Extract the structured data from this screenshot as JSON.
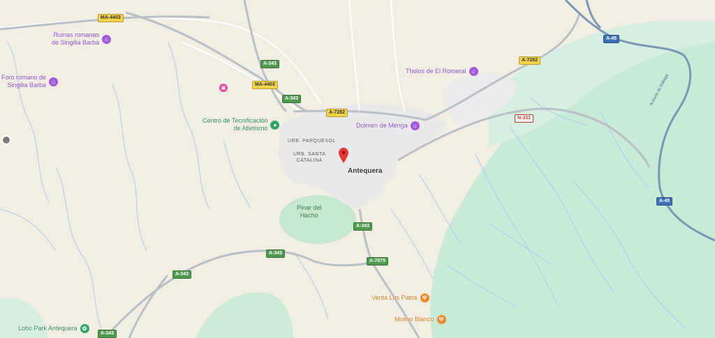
{
  "map": {
    "city": "Antequera",
    "neighborhoods": [
      "URB. PARQUESOL",
      "URB. SANTA\nCATALINA"
    ],
    "park": "Pinar del\nHacho",
    "road_shields": [
      {
        "label": "MA-4403",
        "color": "yellow"
      },
      {
        "label": "MA-4403",
        "color": "yellow"
      },
      {
        "label": "A-343",
        "color": "green"
      },
      {
        "label": "A-343",
        "color": "green"
      },
      {
        "label": "A-7282",
        "color": "yellow"
      },
      {
        "label": "A-7282",
        "color": "yellow"
      },
      {
        "label": "A-45",
        "color": "blue"
      },
      {
        "label": "N-331",
        "color": "red"
      },
      {
        "label": "A-45",
        "color": "blue"
      },
      {
        "label": "A-343",
        "color": "green"
      },
      {
        "label": "A-343",
        "color": "green"
      },
      {
        "label": "A-7075",
        "color": "green"
      },
      {
        "label": "A-343",
        "color": "green"
      },
      {
        "label": "A-343",
        "color": "green"
      }
    ],
    "pois": [
      {
        "label": "Ruinas romanas\nde Singilia Barba",
        "category": "purple",
        "icon": "museum-icon"
      },
      {
        "label": "Foro romano de\nSingilia Barba",
        "category": "purple",
        "icon": "museum-icon"
      },
      {
        "label": "Tholos de El Romeral",
        "category": "purple",
        "icon": "museum-icon"
      },
      {
        "label": "Dolmen de Menga",
        "category": "purple",
        "icon": "museum-icon"
      },
      {
        "label": "Centro de Tecnificación\nde Atletismo",
        "category": "green",
        "icon": "sports-icon"
      },
      {
        "label": "Venta Los Patos",
        "category": "orange",
        "icon": "restaurant-icon"
      },
      {
        "label": "Molino Blanco",
        "category": "orange",
        "icon": "restaurant-icon"
      },
      {
        "label": "Lobo Park Antequera",
        "category": "green",
        "icon": "paw-icon"
      }
    ],
    "motorway_label": "Autovía de Málaga"
  }
}
